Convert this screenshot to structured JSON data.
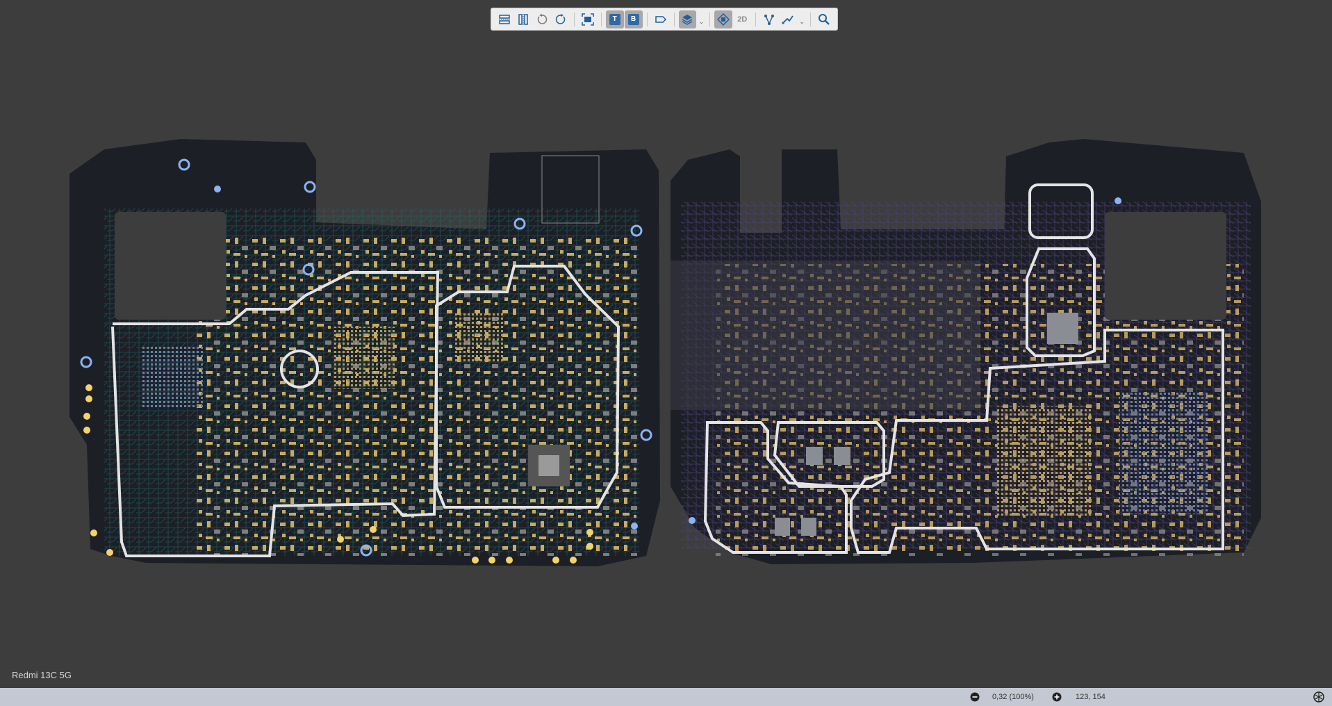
{
  "toolbar": {
    "tools": [
      {
        "icon": "flip-horizontal-icon"
      },
      {
        "icon": "flip-vertical-icon"
      },
      {
        "icon": "rotate-left-icon"
      },
      {
        "icon": "rotate-right-icon"
      },
      {
        "icon": "fit-to-screen-icon"
      },
      {
        "icon": "top-side-icon",
        "label": "T"
      },
      {
        "icon": "bottom-side-icon",
        "label": "B"
      },
      {
        "icon": "label-tag-icon"
      },
      {
        "icon": "layers-icon"
      },
      {
        "icon": "component-view-icon"
      },
      {
        "icon": "view-2d-icon",
        "label": "2D"
      },
      {
        "icon": "net-trace-icon"
      },
      {
        "icon": "measure-icon"
      },
      {
        "icon": "search-icon"
      }
    ]
  },
  "board": {
    "name": "Redmi 13C 5G"
  },
  "status": {
    "zoom": "0,32 (100%)",
    "coordinates": "123, 154"
  },
  "colors": {
    "background": "#3d3d3d",
    "pcb": "#1d1f26",
    "pads": "#e6c36d",
    "shield_outline": "#e4e4e4",
    "accent_blue": "#1f5f9e",
    "statusbar": "#c3c8d2"
  }
}
